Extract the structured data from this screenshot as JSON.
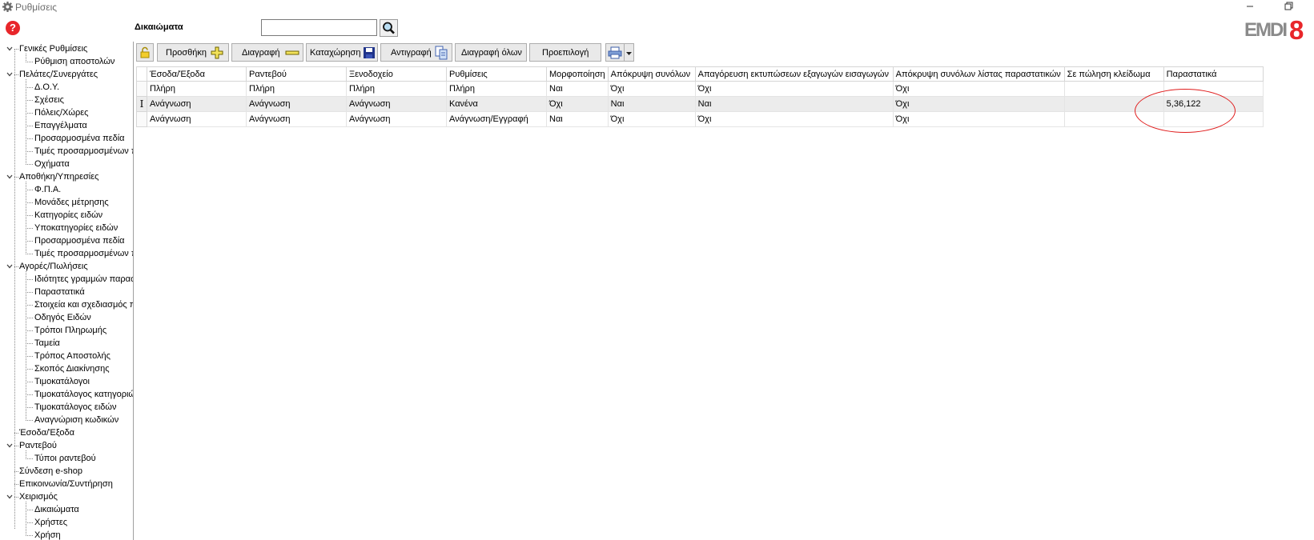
{
  "window": {
    "title": "Ρυθμίσεις"
  },
  "header": {
    "help_label": "?",
    "section_title": "Δικαιώματα",
    "search": {
      "value": "",
      "placeholder": ""
    },
    "logo": {
      "text": "EMDI",
      "digit": "8",
      "brand_color": "#e8262a"
    }
  },
  "sidebar": {
    "items": [
      {
        "label": "Γενικές Ρυθμίσεις",
        "level": 0,
        "expanded": true
      },
      {
        "label": "Ρύθμιση αποστολών",
        "level": 1
      },
      {
        "label": "Πελάτες/Συνεργάτες",
        "level": 0,
        "expanded": true
      },
      {
        "label": "Δ.Ο.Υ.",
        "level": 1
      },
      {
        "label": "Σχέσεις",
        "level": 1
      },
      {
        "label": "Πόλεις/Χώρες",
        "level": 1
      },
      {
        "label": "Επαγγέλματα",
        "level": 1
      },
      {
        "label": "Προσαρμοσμένα πεδία",
        "level": 1
      },
      {
        "label": "Τιμές προσαρμοσμένων π",
        "level": 1
      },
      {
        "label": "Οχήματα",
        "level": 1
      },
      {
        "label": "Αποθήκη/Υπηρεσίες",
        "level": 0,
        "expanded": true
      },
      {
        "label": "Φ.Π.Α.",
        "level": 1
      },
      {
        "label": "Μονάδες μέτρησης",
        "level": 1
      },
      {
        "label": "Κατηγορίες ειδών",
        "level": 1
      },
      {
        "label": "Υποκατηγορίες ειδών",
        "level": 1
      },
      {
        "label": "Προσαρμοσμένα πεδία",
        "level": 1
      },
      {
        "label": "Τιμές προσαρμοσμένων π",
        "level": 1
      },
      {
        "label": "Αγορές/Πωλήσεις",
        "level": 0,
        "expanded": true
      },
      {
        "label": "Ιδιότητες γραμμών παρασ",
        "level": 1
      },
      {
        "label": "Παραστατικά",
        "level": 1
      },
      {
        "label": "Στοιχεία και σχεδιασμός π",
        "level": 1
      },
      {
        "label": "Οδηγός Ειδών",
        "level": 1
      },
      {
        "label": "Τρόποι Πληρωμής",
        "level": 1
      },
      {
        "label": "Ταμεία",
        "level": 1
      },
      {
        "label": "Τρόπος Αποστολής",
        "level": 1
      },
      {
        "label": "Σκοπός Διακίνησης",
        "level": 1
      },
      {
        "label": "Τιμοκατάλογοι",
        "level": 1
      },
      {
        "label": "Τιμοκατάλογος κατηγοριώ",
        "level": 1
      },
      {
        "label": "Τιμοκατάλογος ειδών",
        "level": 1
      },
      {
        "label": "Αναγνώριση κωδικών",
        "level": 1
      },
      {
        "label": "Έσοδα/Έξοδα",
        "level": 0
      },
      {
        "label": "Ραντεβού",
        "level": 0,
        "expanded": true
      },
      {
        "label": "Τύποι ραντεβού",
        "level": 1
      },
      {
        "label": "Σύνδεση e-shop",
        "level": 0
      },
      {
        "label": "Επικοινωνία/Συντήρηση",
        "level": 0
      },
      {
        "label": "Χειρισμός",
        "level": 0,
        "expanded": true
      },
      {
        "label": "Δικαιώματα",
        "level": 1
      },
      {
        "label": "Χρήστες",
        "level": 1
      },
      {
        "label": "Χρήση",
        "level": 1
      }
    ]
  },
  "toolbar": {
    "add_label": "Προσθήκη",
    "delete_label": "Διαγραφή",
    "save_label": "Καταχώρηση",
    "copy_label": "Αντιγραφή",
    "delete_all_label": "Διαγραφή όλων",
    "default_label": "Προεπιλογή",
    "icons": {
      "lock": "lock-icon",
      "add": "plus-icon",
      "delete": "minus-icon",
      "save": "floppy-icon",
      "copy": "copy-icon",
      "print": "printer-icon",
      "dropdown": "chevron-down-icon"
    }
  },
  "grid": {
    "columns": [
      "Έσοδα/Έξοδα",
      "Ραντεβού",
      "Ξενοδοχείο",
      "Ρυθμίσεις",
      "Μορφοποίηση",
      "Απόκρυψη συνόλων",
      "Απαγόρευση εκτυπώσεων εξαγωγών εισαγωγών",
      "Απόκρυψη συνόλων λίστας παραστατικών",
      "Σε πώληση κλείδωμα",
      "Παραστατικά"
    ],
    "rows": [
      [
        "Πλήρη",
        "Πλήρη",
        "Πλήρη",
        "Πλήρη",
        "Ναι",
        "Όχι",
        "Όχι",
        "Όχι",
        "",
        ""
      ],
      [
        "Ανάγνωση",
        "Ανάγνωση",
        "Ανάγνωση",
        "Κανένα",
        "Όχι",
        "Ναι",
        "Ναι",
        "Όχι",
        "",
        "5,36,122"
      ],
      [
        "Ανάγνωση",
        "Ανάγνωση",
        "Ανάγνωση",
        "Ανάγνωση/Εγγραφή",
        "Ναι",
        "Όχι",
        "Όχι",
        "Όχι",
        "",
        ""
      ]
    ],
    "selected_row": 1,
    "edit_cursor": "I"
  }
}
